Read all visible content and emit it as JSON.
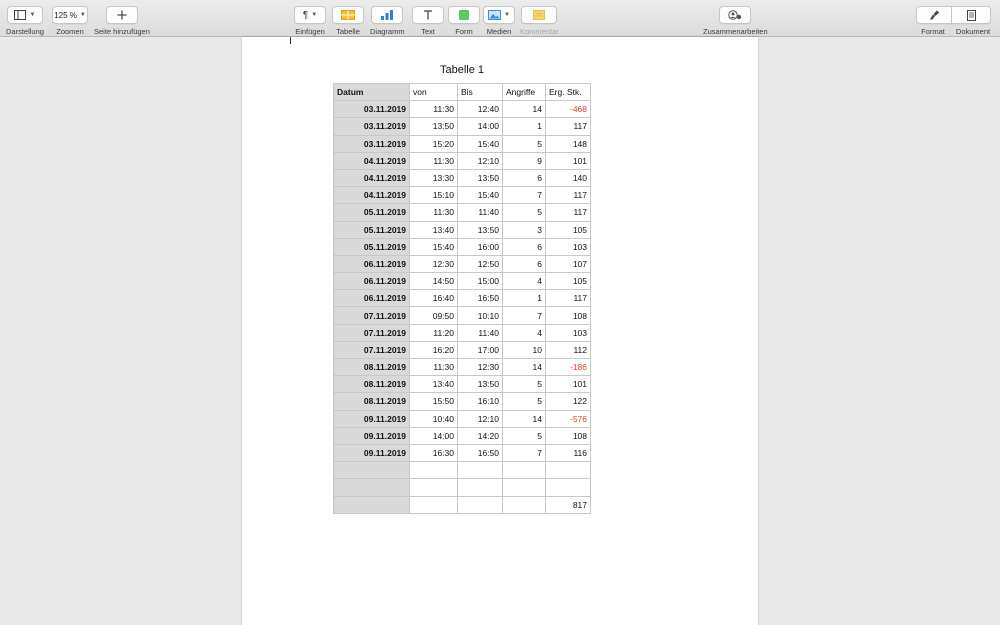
{
  "toolbar": {
    "darstellung": "Darstellung",
    "zoom_value": "125 %",
    "zoomen": "Zoomen",
    "seite_hinzufuegen": "Seite hinzufügen",
    "einfuegen": "Einfügen",
    "tabelle": "Tabelle",
    "diagramm": "Diagramm",
    "text": "Text",
    "form": "Form",
    "medien": "Medien",
    "kommentar": "Kommentar",
    "zusammenarbeiten": "Zusammenarbeiten",
    "format": "Format",
    "dokument": "Dokument",
    "colors": {
      "tabelle_icon": "#f5c12e",
      "diagramm_icon": "#2f7fd8",
      "form_icon": "#5cc66a",
      "medien_icon": "#3d8de0",
      "kommentar_icon": "#f5d86a"
    }
  },
  "document": {
    "table_title": "Tabelle 1",
    "headers": [
      "Datum",
      "von",
      "Bis",
      "Angriffe",
      "Erg. Stk."
    ],
    "rows": [
      {
        "datum": "03.11.2019",
        "von": "11:30",
        "bis": "12:40",
        "angriffe": "14",
        "erg": "-468"
      },
      {
        "datum": "03.11.2019",
        "von": "13:50",
        "bis": "14:00",
        "angriffe": "1",
        "erg": "117"
      },
      {
        "datum": "03.11.2019",
        "von": "15:20",
        "bis": "15:40",
        "angriffe": "5",
        "erg": "148"
      },
      {
        "datum": "04.11.2019",
        "von": "11:30",
        "bis": "12:10",
        "angriffe": "9",
        "erg": "101"
      },
      {
        "datum": "04.11.2019",
        "von": "13:30",
        "bis": "13:50",
        "angriffe": "6",
        "erg": "140"
      },
      {
        "datum": "04.11.2019",
        "von": "15:10",
        "bis": "15:40",
        "angriffe": "7",
        "erg": "117"
      },
      {
        "datum": "05.11.2019",
        "von": "11:30",
        "bis": "11:40",
        "angriffe": "5",
        "erg": "117"
      },
      {
        "datum": "05.11.2019",
        "von": "13:40",
        "bis": "13:50",
        "angriffe": "3",
        "erg": "105"
      },
      {
        "datum": "05.11.2019",
        "von": "15:40",
        "bis": "16:00",
        "angriffe": "6",
        "erg": "103"
      },
      {
        "datum": "06.11.2019",
        "von": "12:30",
        "bis": "12:50",
        "angriffe": "6",
        "erg": "107"
      },
      {
        "datum": "06.11.2019",
        "von": "14:50",
        "bis": "15:00",
        "angriffe": "4",
        "erg": "105"
      },
      {
        "datum": "06.11.2019",
        "von": "16:40",
        "bis": "16:50",
        "angriffe": "1",
        "erg": "117"
      },
      {
        "datum": "07.11.2019",
        "von": "09:50",
        "bis": "10:10",
        "angriffe": "7",
        "erg": "108"
      },
      {
        "datum": "07.11.2019",
        "von": "11:20",
        "bis": "11:40",
        "angriffe": "4",
        "erg": "103"
      },
      {
        "datum": "07.11.2019",
        "von": "16:20",
        "bis": "17:00",
        "angriffe": "10",
        "erg": "112"
      },
      {
        "datum": "08.11.2019",
        "von": "11:30",
        "bis": "12:30",
        "angriffe": "14",
        "erg": "-186"
      },
      {
        "datum": "08.11.2019",
        "von": "13:40",
        "bis": "13:50",
        "angriffe": "5",
        "erg": "101"
      },
      {
        "datum": "08.11.2019",
        "von": "15:50",
        "bis": "16:10",
        "angriffe": "5",
        "erg": "122"
      },
      {
        "datum": "09.11.2019",
        "von": "10:40",
        "bis": "12:10",
        "angriffe": "14",
        "erg": "-576"
      },
      {
        "datum": "09.11.2019",
        "von": "14:00",
        "bis": "14:20",
        "angriffe": "5",
        "erg": "108"
      },
      {
        "datum": "09.11.2019",
        "von": "16:30",
        "bis": "16:50",
        "angriffe": "7",
        "erg": "116"
      },
      {
        "datum": "",
        "von": "",
        "bis": "",
        "angriffe": "",
        "erg": ""
      },
      {
        "datum": "",
        "von": "",
        "bis": "",
        "angriffe": "",
        "erg": ""
      },
      {
        "datum": "",
        "von": "",
        "bis": "",
        "angriffe": "",
        "erg": "817"
      }
    ],
    "negative_color": "#d9432a"
  }
}
